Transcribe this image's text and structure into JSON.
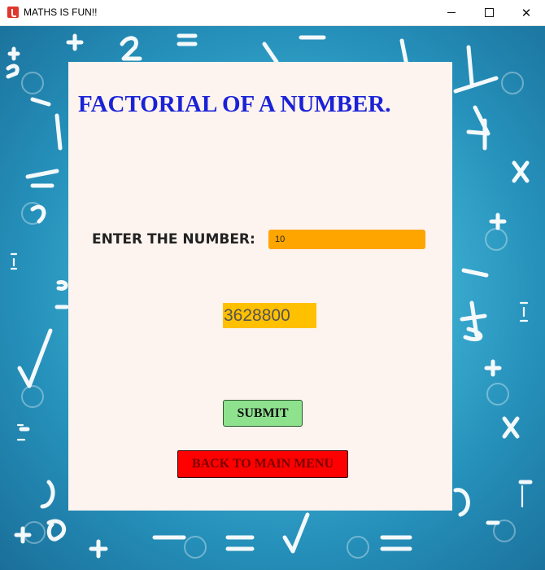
{
  "window": {
    "title": "MATHS IS FUN!!",
    "app_icon": "java-cup-icon",
    "controls": {
      "minimize": "minimize-icon",
      "maximize": "maximize-icon",
      "close": "✕"
    }
  },
  "page": {
    "heading": "FACTORIAL OF A NUMBER.",
    "number_label": "ENTER THE NUMBER:",
    "number_value": "10",
    "result": "3628800",
    "submit_label": "SUBMIT",
    "back_label": "BACK TO MAIN MENU"
  },
  "colors": {
    "heading": "#1a22d6",
    "input_bg": "#ffa500",
    "result_bg": "#ffc000",
    "submit_bg": "#8ee28e",
    "back_bg": "#ff0000",
    "panel_bg": "#fdf3ef",
    "backdrop": "#2590ba"
  }
}
